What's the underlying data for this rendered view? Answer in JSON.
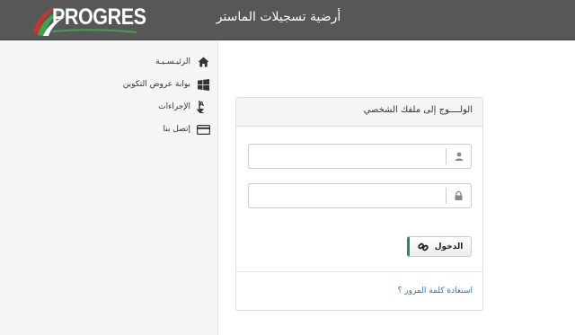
{
  "header": {
    "logo_text": "PROGRES",
    "title": "أرضية تسجيلات الماستر"
  },
  "sidebar": {
    "items": [
      {
        "label": "الرئيـسـيـة",
        "icon": "home-icon"
      },
      {
        "label": "بوابة عروض التكوين",
        "icon": "windows-icon"
      },
      {
        "label": "الإجراءات",
        "icon": "sort-alpha-icon"
      },
      {
        "label": "إتصل بنا",
        "icon": "credit-card-icon"
      }
    ]
  },
  "login": {
    "heading": "الولــــوج إلى ملفك الشخصي",
    "username": {
      "value": "",
      "placeholder": "",
      "icon": "user-icon"
    },
    "password": {
      "value": "",
      "placeholder": "",
      "icon": "lock-icon"
    },
    "submit_label": "الدخول",
    "submit_icon": "link-icon",
    "recover_link": "استعادة كلمة المرور ؟"
  },
  "colors": {
    "header_bg": "#575757",
    "sidebar_bg": "#f5f5f5",
    "logo_green": "#3fa34d",
    "logo_red": "#c0392b",
    "button_accent": "#2e8b57",
    "link": "#3a6f9a"
  }
}
